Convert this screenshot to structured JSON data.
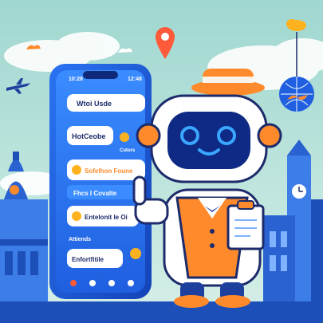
{
  "phone": {
    "status_time": "10:28",
    "battery": "12:48",
    "messages": [
      {
        "text": "Wtoi Usde"
      },
      {
        "text": "HotCeobe"
      },
      {
        "text": "Cutors"
      },
      {
        "text": "Sofelhon Foune"
      },
      {
        "text": "Fhcs I Covalte"
      },
      {
        "text": "Entelonit Ie Oi"
      },
      {
        "text": "Attiends"
      },
      {
        "text": "Enfortfitile"
      }
    ]
  },
  "colors": {
    "sky": "#bfe3da",
    "phone_blue": "#1f5fe0",
    "robot_orange": "#ff8a2b",
    "screen_glow": "#3aa6ff"
  },
  "icons": [
    "location-pin-icon",
    "cloud-icon",
    "airplane-icon",
    "globe-lantern-icon",
    "sun-icon"
  ]
}
